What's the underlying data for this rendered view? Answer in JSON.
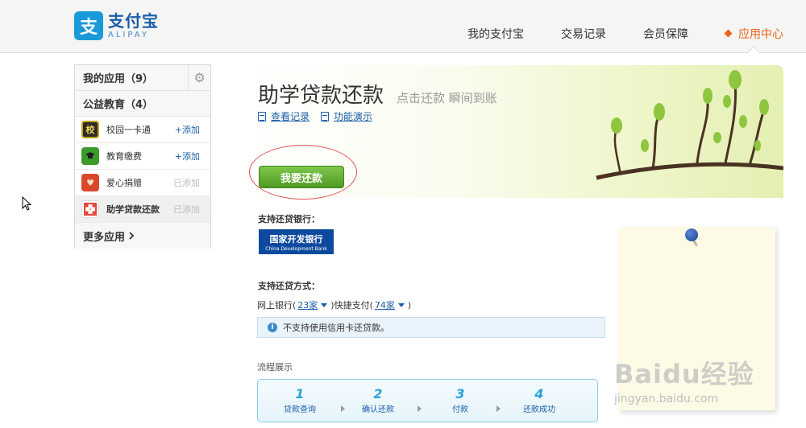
{
  "header": {
    "logo_mark": "支",
    "logo_cn": "支付宝",
    "logo_en": "ALIPAY",
    "nav": [
      {
        "label": "我的支付宝"
      },
      {
        "label": "交易记录"
      },
      {
        "label": "会员保障"
      },
      {
        "label": "应用中心"
      }
    ],
    "active_nav": "应用中心",
    "accent_color": "#e8651a"
  },
  "sidebar": {
    "my_apps_label": "我的应用（9）",
    "category_label": "公益教育（4）",
    "items": [
      {
        "icon": "school-card-icon",
        "icon_text": "校",
        "label": "校园一卡通",
        "action": "+添加",
        "added": false
      },
      {
        "icon": "graduation-cap-icon",
        "icon_text": "▰",
        "label": "教育缴费",
        "action": "+添加",
        "added": false
      },
      {
        "icon": "heart-gift-icon",
        "icon_text": "♥",
        "label": "爱心捐赠",
        "action": "已添加",
        "added": true
      },
      {
        "icon": "loan-cross-icon",
        "icon_text": "",
        "label": "助学贷款还款",
        "action": "已添加",
        "added": true
      }
    ],
    "more_label": "更多应用"
  },
  "main": {
    "title": "助学贷款还款",
    "subtitle": "点击还款 瞬间到账",
    "links": [
      {
        "label": "查看记录"
      },
      {
        "label": "功能演示"
      }
    ],
    "repay_button": "我要还款",
    "banks_label": "支持还贷银行：",
    "bank_logo_cn": "国家开发银行",
    "bank_logo_en": "China Development Bank",
    "methods_label": "支持还贷方式：",
    "methods": {
      "online_bank_prefix": "网上银行(",
      "online_bank_count": "23家",
      "quick_pay_prefix": ")快捷支付(",
      "quick_pay_count": "74家",
      "suffix": ")"
    },
    "notice": "不支持使用信用卡还贷款。",
    "flow_label": "流程展示",
    "steps": [
      {
        "num": "1",
        "label": "贷款查询"
      },
      {
        "num": "2",
        "label": "确认还款"
      },
      {
        "num": "3",
        "label": "付款"
      },
      {
        "num": "4",
        "label": "还款成功"
      }
    ]
  },
  "watermark": {
    "main": "Baidu经验",
    "sub": "jingyan.baidu.com"
  }
}
